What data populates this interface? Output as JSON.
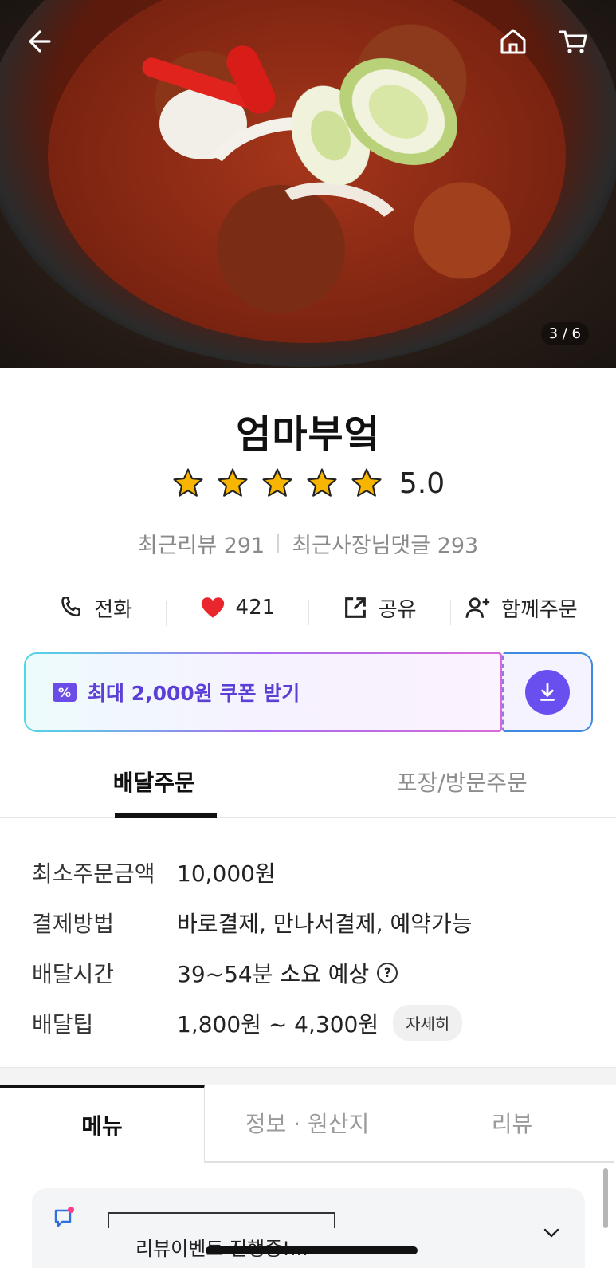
{
  "hero": {
    "image_counter": "3 / 6",
    "icons": [
      "back-arrow-icon",
      "home-icon",
      "cart-icon"
    ]
  },
  "store": {
    "name": "엄마부엌",
    "rating": "5.0",
    "stars": 5,
    "recent_reviews": "최근리뷰 291",
    "owner_replies": "최근사장님댓글 293"
  },
  "actions": {
    "call": "전화",
    "likes": "421",
    "share": "공유",
    "group_order": "함께주문"
  },
  "coupon": {
    "label": "최대 2,000원 쿠폰 받기",
    "icon_text": "%"
  },
  "order_tabs": {
    "delivery": "배달주문",
    "pickup": "포장/방문주문"
  },
  "info": [
    {
      "label": "최소주문금액",
      "value": "10,000원"
    },
    {
      "label": "결제방법",
      "value": "바로결제, 만나서결제, 예약가능"
    },
    {
      "label": "배달시간",
      "value": "39~54분 소요 예상"
    },
    {
      "label": "배달팁",
      "value": "1,800원 ~ 4,300원",
      "button": "자세히"
    }
  ],
  "menu_tabs": {
    "menu": "메뉴",
    "info_origin": "정보 · 원산지",
    "review": "리뷰"
  },
  "event": {
    "text": "리뷰이벤트 진행중!..."
  },
  "colors": {
    "accent_purple": "#6a4ff0",
    "heart_red": "#e8262c",
    "star_yellow": "#f7b500"
  }
}
